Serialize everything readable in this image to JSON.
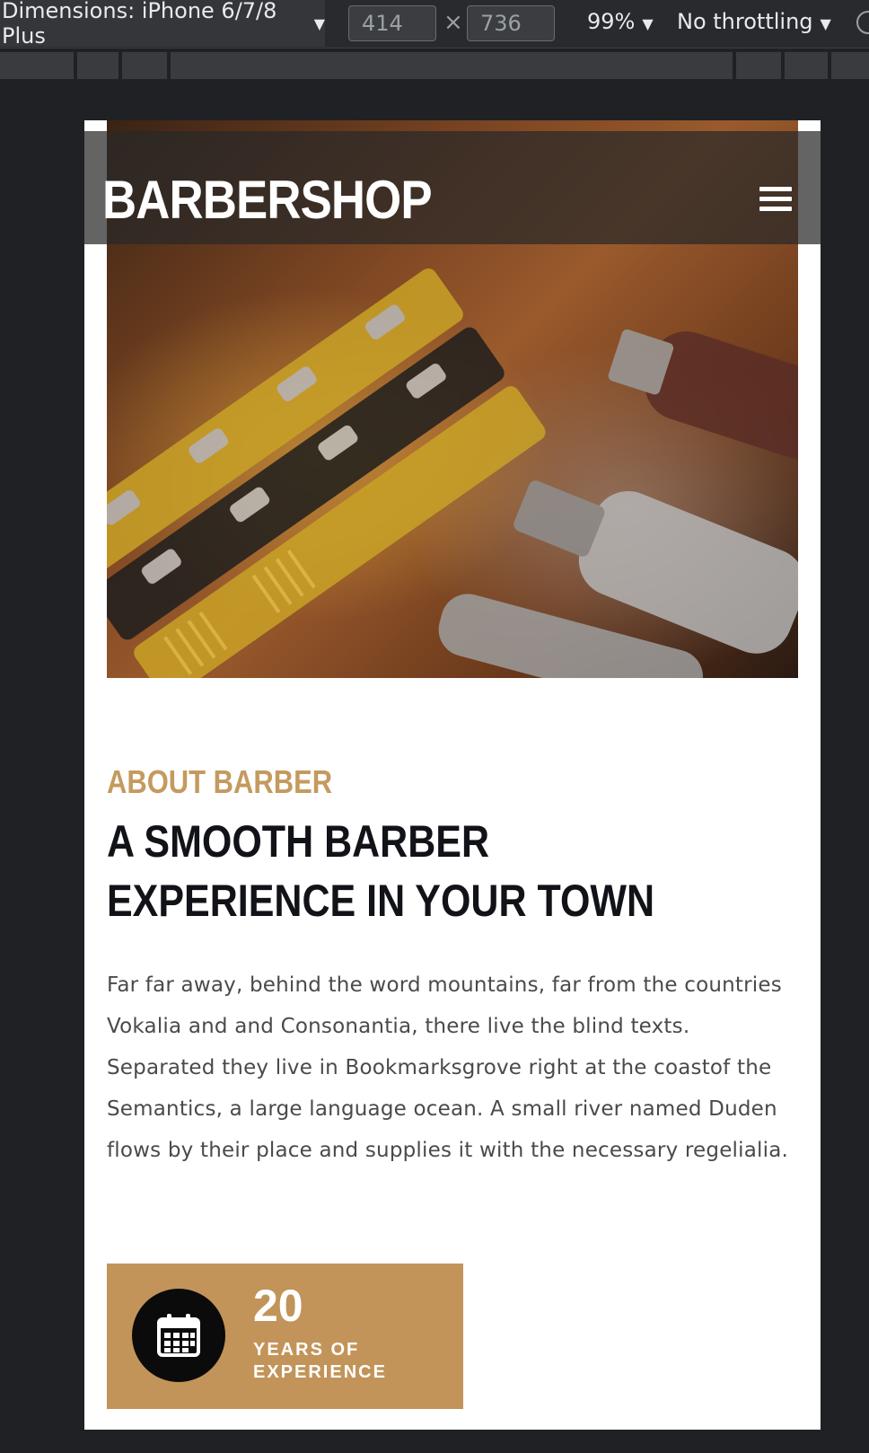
{
  "devtools": {
    "device_label": "Dimensions: iPhone 6/7/8 Plus",
    "width_value": "414",
    "height_value": "736",
    "times_symbol": "×",
    "zoom_label": "99%",
    "throttle_label": "No throttling",
    "caret": "▼"
  },
  "site": {
    "brand": "BARBERSHOP",
    "menu_icon": "hamburger-icon",
    "about_label": "ABOUT BARBER",
    "headline_line1": "A SMOOTH BARBER",
    "headline_line2": "EXPERIENCE IN YOUR TOWN",
    "body": "Far far away, behind the word mountains, far from the countries Vokalia and and Consonantia, there live the blind texts. Separated they live in Bookmarksgrove right at the coastof the Semantics, a large language ocean. A small river named Duden flows by their place and supplies it with the necessary regelialia.",
    "experience": {
      "icon": "calendar-icon",
      "number": "20",
      "label_line1": "YEARS OF",
      "label_line2": "EXPERIENCE"
    },
    "colors": {
      "accent": "#c29459",
      "accent_text": "#c49a5e",
      "heading": "#111318"
    }
  }
}
